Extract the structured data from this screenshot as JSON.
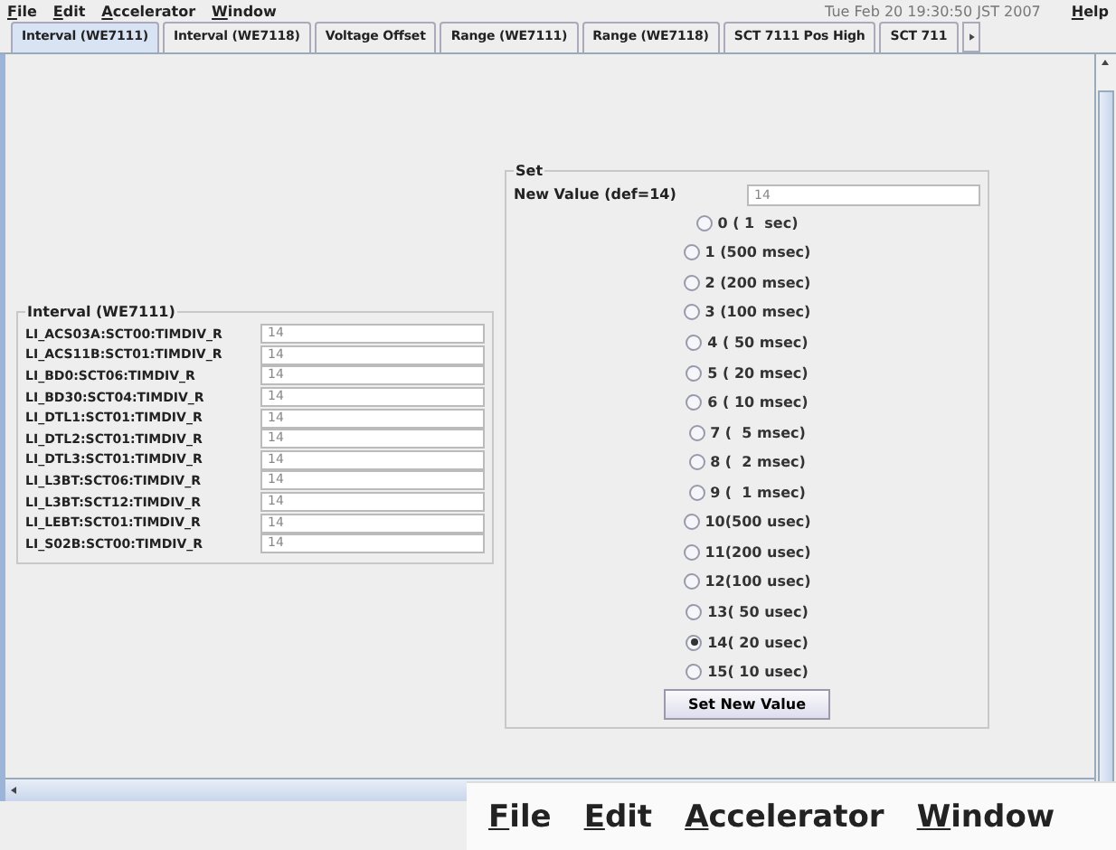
{
  "menu": [
    "File",
    "Edit",
    "Accelerator",
    "Window"
  ],
  "clock": "Tue Feb 20 19:30:50 JST 2007",
  "help_menu": "Help",
  "tabs": [
    {
      "label": "Interval (WE7111)",
      "selected": true
    },
    {
      "label": "Interval (WE7118)",
      "selected": false
    },
    {
      "label": "Voltage Offset",
      "selected": false
    },
    {
      "label": "Range (WE7111)",
      "selected": false
    },
    {
      "label": "Range (WE7118)",
      "selected": false
    },
    {
      "label": "SCT 7111 Pos High",
      "selected": false
    },
    {
      "label": "SCT 711",
      "selected": false
    }
  ],
  "interval_panel": {
    "title": "Interval (WE7111)",
    "rows": [
      {
        "name": "LI_ACS03A:SCT00:TIMDIV_R",
        "value": "14"
      },
      {
        "name": "LI_ACS11B:SCT01:TIMDIV_R",
        "value": "14"
      },
      {
        "name": "LI_BD0:SCT06:TIMDIV_R",
        "value": "14"
      },
      {
        "name": "LI_BD30:SCT04:TIMDIV_R",
        "value": "14"
      },
      {
        "name": "LI_DTL1:SCT01:TIMDIV_R",
        "value": "14"
      },
      {
        "name": "LI_DTL2:SCT01:TIMDIV_R",
        "value": "14"
      },
      {
        "name": "LI_DTL3:SCT01:TIMDIV_R",
        "value": "14"
      },
      {
        "name": "LI_L3BT:SCT06:TIMDIV_R",
        "value": "14"
      },
      {
        "name": "LI_L3BT:SCT12:TIMDIV_R",
        "value": "14"
      },
      {
        "name": "LI_LEBT:SCT01:TIMDIV_R",
        "value": "14"
      },
      {
        "name": "LI_S02B:SCT00:TIMDIV_R",
        "value": "14"
      }
    ]
  },
  "set_panel": {
    "title": "Set",
    "new_value_label": "New Value (def=14)",
    "new_value": "14",
    "options": [
      {
        "label": "0 ( 1  sec)",
        "selected": false
      },
      {
        "label": "1 (500 msec)",
        "selected": false
      },
      {
        "label": "2 (200 msec)",
        "selected": false
      },
      {
        "label": "3 (100 msec)",
        "selected": false
      },
      {
        "label": "4 ( 50 msec)",
        "selected": false
      },
      {
        "label": "5 ( 20 msec)",
        "selected": false
      },
      {
        "label": "6 ( 10 msec)",
        "selected": false
      },
      {
        "label": "7 (  5 msec)",
        "selected": false
      },
      {
        "label": "8 (  2 msec)",
        "selected": false
      },
      {
        "label": "9 (  1 msec)",
        "selected": false
      },
      {
        "label": "10(500 usec)",
        "selected": false
      },
      {
        "label": "11(200 usec)",
        "selected": false
      },
      {
        "label": "12(100 usec)",
        "selected": false
      },
      {
        "label": "13( 50 usec)",
        "selected": false
      },
      {
        "label": "14( 20 usec)",
        "selected": true
      },
      {
        "label": "15( 10 usec)",
        "selected": false
      }
    ],
    "button": "Set New Value"
  },
  "zoomed_menu": [
    "File",
    "Edit",
    "Accelerator",
    "Window"
  ]
}
